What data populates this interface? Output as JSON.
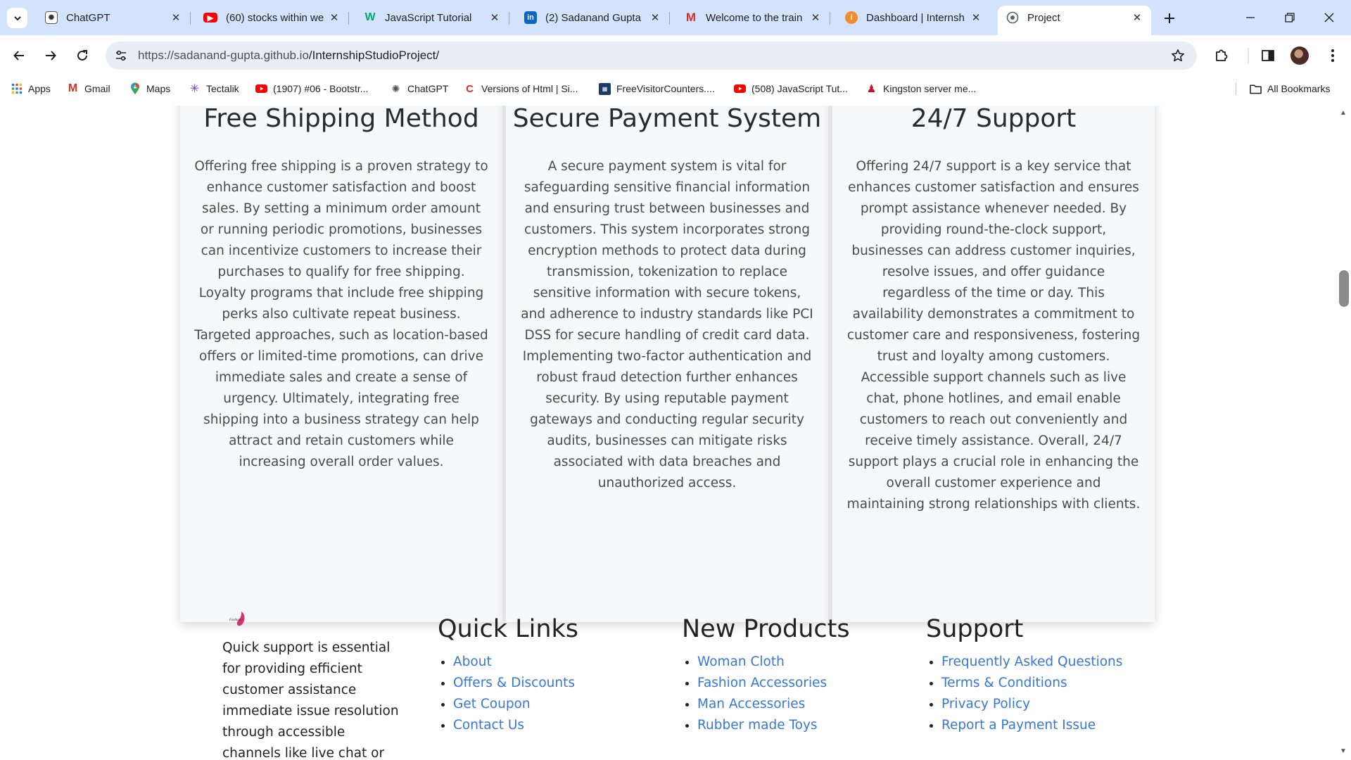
{
  "browser": {
    "tabs": [
      {
        "title": "ChatGPT",
        "icon": "chatgpt-icon"
      },
      {
        "title": "(60) stocks within we",
        "icon": "youtube-icon"
      },
      {
        "title": "JavaScript Tutorial",
        "icon": "w3schools-icon"
      },
      {
        "title": "(2) Sadanand Gupta",
        "icon": "linkedin-icon"
      },
      {
        "title": "Welcome to the train",
        "icon": "gmail-icon"
      },
      {
        "title": "Dashboard | Internsh",
        "icon": "internshala-icon"
      },
      {
        "title": "Project",
        "icon": "globe-icon",
        "active": true
      }
    ],
    "url_host": "https://sadanand-gupta.github.io",
    "url_path": "/InternshipStudioProject/",
    "bookmarks": [
      {
        "label": "Apps",
        "icon": "apps-grid-icon"
      },
      {
        "label": "Gmail",
        "icon": "gmail-icon"
      },
      {
        "label": "Maps",
        "icon": "maps-icon"
      },
      {
        "label": "Tectalik",
        "icon": "tectalik-icon"
      },
      {
        "label": "(1907) #06 - Bootstr...",
        "icon": "youtube-icon"
      },
      {
        "label": "ChatGPT",
        "icon": "chatgpt-icon"
      },
      {
        "label": "Versions of Html | Si...",
        "icon": "site-icon"
      },
      {
        "label": "FreeVisitorCounters....",
        "icon": "counter-icon"
      },
      {
        "label": "(508) JavaScript Tut...",
        "icon": "youtube-icon"
      },
      {
        "label": "Kingston server me...",
        "icon": "kingston-icon"
      }
    ],
    "all_bookmarks": "All Bookmarks",
    "colors": {
      "tabstrip": "#d3e3fd",
      "omnibox": "#e9eef6",
      "link": "#3777d6"
    }
  },
  "features": [
    {
      "title": "Free Shipping Method",
      "text": "Offering free shipping is a proven strategy to enhance customer satisfaction and boost sales. By setting a minimum order amount or running periodic promotions, businesses can incentivize customers to increase their purchases to qualify for free shipping. Loyalty programs that include free shipping perks also cultivate repeat business. Targeted approaches, such as location-based offers or limited-time promotions, can drive immediate sales and create a sense of urgency. Ultimately, integrating free shipping into a business strategy can help attract and retain customers while increasing overall order values."
    },
    {
      "title": "Secure Payment System",
      "text": "A secure payment system is vital for safeguarding sensitive financial information and ensuring trust between businesses and customers. This system incorporates strong encryption methods to protect data during transmission, tokenization to replace sensitive information with secure tokens, and adherence to industry standards like PCI DSS for secure handling of credit card data. Implementing two-factor authentication and robust fraud detection further enhances security. By using reputable payment gateways and conducting regular security audits, businesses can mitigate risks associated with data breaches and unauthorized access."
    },
    {
      "title": "24/7 Support",
      "text": "Offering 24/7 support is a key service that enhances customer satisfaction and ensures prompt assistance whenever needed. By providing round-the-clock support, businesses can address customer inquiries, resolve issues, and offer guidance regardless of the time or day. This availability demonstrates a commitment to customer care and responsiveness, fostering trust and loyalty among customers. Accessible support channels such as live chat, phone hotlines, and email enable customers to reach out conveniently and receive timely assistance. Overall, 24/7 support plays a crucial role in enhancing the overall customer experience and maintaining strong relationships with clients."
    }
  ],
  "footer": {
    "about": "Quick support is essential for providing efficient customer assistance immediate issue resolution through accessible channels like live chat or phone support.",
    "quick_links": {
      "heading": "Quick Links",
      "items": [
        "About",
        "Offers & Discounts",
        "Get Coupon",
        "Contact Us"
      ]
    },
    "new_products": {
      "heading": "New Products",
      "items": [
        "Woman Cloth",
        "Fashion Accessories",
        "Man Accessories",
        "Rubber made Toys"
      ]
    },
    "support": {
      "heading": "Support",
      "items": [
        "Frequently Asked Questions",
        "Terms & Conditions",
        "Privacy Policy",
        "Report a Payment Issue"
      ]
    }
  }
}
